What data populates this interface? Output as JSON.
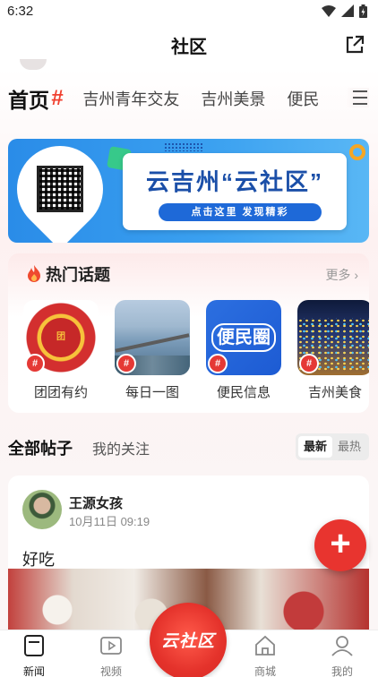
{
  "status_bar": {
    "time": "6:32",
    "icons": [
      "wifi-icon",
      "signal-icon",
      "battery-icon"
    ]
  },
  "app_bar": {
    "title": "社区",
    "share_icon": "share-icon"
  },
  "tabs": {
    "home": "首页",
    "home_hash": "#",
    "items": [
      "吉州青年交友",
      "吉州美景",
      "便民"
    ],
    "menu_icon": "menu-icon"
  },
  "banner": {
    "headline": "云吉州“云社区”",
    "cta": "点击这里  发现精彩"
  },
  "hot_topics": {
    "title": "热门话题",
    "more": "更多 ›",
    "items": [
      {
        "label": "团团有约",
        "badge": "#"
      },
      {
        "label": "每日一图",
        "badge": "#"
      },
      {
        "label": "便民信息",
        "badge": "#",
        "thumb_text": "便民圈"
      },
      {
        "label": "吉州美食",
        "badge": "#"
      }
    ]
  },
  "posts": {
    "tab_all": "全部帖子",
    "tab_follow": "我的关注",
    "sort": {
      "options": [
        "最新",
        "最热"
      ],
      "selected": "最新"
    }
  },
  "post": {
    "author": "王源女孩",
    "time": "10月11日 09:19",
    "content": "好吃"
  },
  "fab": {
    "label": "+"
  },
  "bottom_nav": {
    "items": [
      {
        "label": "新闻",
        "icon": "news-icon"
      },
      {
        "label": "视频",
        "icon": "video-icon"
      },
      {
        "label": "云社区",
        "icon": "community-icon"
      },
      {
        "label": "商城",
        "icon": "shop-icon"
      },
      {
        "label": "我的",
        "icon": "profile-icon"
      }
    ]
  },
  "colors": {
    "accent": "#e8342f",
    "banner_blue": "#2a8ce8",
    "text": "#222222"
  }
}
